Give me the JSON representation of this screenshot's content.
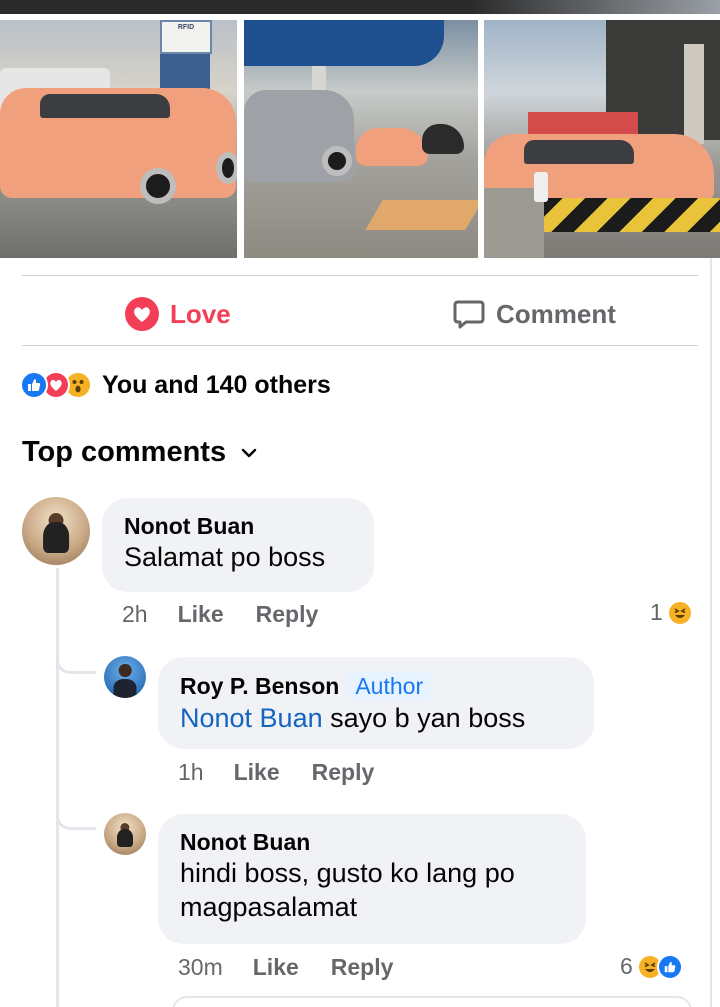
{
  "photos": [
    {
      "label": "car-photo-1",
      "sign_text": "RFID"
    },
    {
      "label": "car-photo-2"
    },
    {
      "label": "car-photo-3"
    }
  ],
  "actions": {
    "love_label": "Love",
    "comment_label": "Comment"
  },
  "reactions": {
    "summary": "You and 140 others",
    "icons": [
      "like-icon",
      "heart-icon",
      "wow-icon"
    ]
  },
  "comments_header": {
    "title": "Top comments"
  },
  "comments": [
    {
      "author": "Nonot Buan",
      "text": "Salamat po boss",
      "time": "2h",
      "like_label": "Like",
      "reply_label": "Reply",
      "reaction_count": "1",
      "reaction_icons": [
        "haha-icon"
      ]
    },
    {
      "author": "Roy P. Benson",
      "badge": "Author",
      "mention": "Nonot Buan",
      "text": " sayo b yan boss",
      "time": "1h",
      "like_label": "Like",
      "reply_label": "Reply"
    },
    {
      "author": "Nonot Buan",
      "text_line1": "hindi boss, gusto ko lang po",
      "text_line2": "magpasalamat",
      "time": "30m",
      "like_label": "Like",
      "reply_label": "Reply",
      "reaction_count": "6",
      "reaction_icons": [
        "haha-icon",
        "like-icon"
      ]
    }
  ],
  "colors": {
    "love": "#f33e58",
    "link_blue": "#1877f2",
    "muted": "#65676b",
    "bubble": "#f0f2f5"
  }
}
